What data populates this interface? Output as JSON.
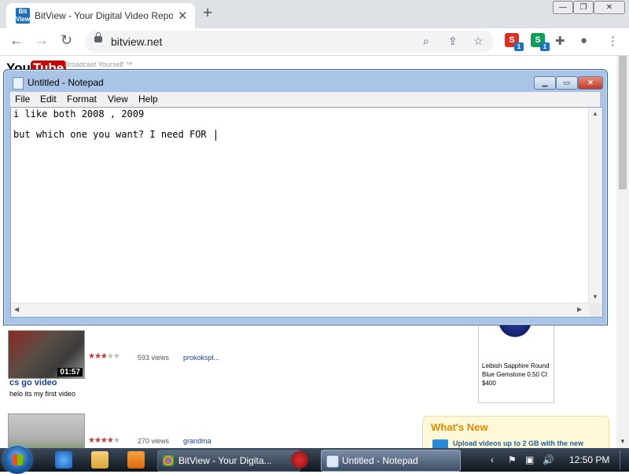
{
  "browser": {
    "tab_title": "BitView - Your Digital Video Repository",
    "favicon_text": "Bit View",
    "tab_close": "✕",
    "new_tab": "+",
    "url": "bitview.net",
    "window_controls": {
      "minimize": "—",
      "maximize": "❐",
      "close": "✕"
    },
    "nav": {
      "back": "←",
      "forward": "→",
      "reload": "↻"
    },
    "extensions": [
      {
        "name": "extension-s-1",
        "letter": "S",
        "badge": "1",
        "color": "#d93025"
      },
      {
        "name": "extension-s-2",
        "letter": "S",
        "badge": "1",
        "color": "#0f9d58"
      }
    ],
    "icons": {
      "zoom": "search-icon",
      "share": "share-icon",
      "bookmark": "star-icon",
      "extensions": "puzzle-icon",
      "profile": "person-icon",
      "menu": "kebab-menu-icon"
    }
  },
  "page": {
    "logo_you": "You",
    "logo_tube": "Tube",
    "tagline": "Broadcast Yourself ™",
    "videos": [
      {
        "title": "cs go video",
        "description": "helo its my first video",
        "duration": "01:57",
        "views": "593 views",
        "author": "prokokspl...",
        "rating": 3.5
      },
      {
        "title": "",
        "description": "",
        "duration": "",
        "views": "270 views",
        "author": "grandma",
        "rating": 4.5
      }
    ],
    "ad_text": "Leibish Sapphire Round Blue Gemstone 0.50 Ct $400",
    "whats_new": {
      "title": "What's New",
      "text": "Upload videos up to 2 GB with the new"
    }
  },
  "notepad": {
    "title": "Untitled - Notepad",
    "menus": [
      "File",
      "Edit",
      "Format",
      "View",
      "Help"
    ],
    "controls": {
      "minimize": "▁",
      "maximize": "▭",
      "close": "✕"
    },
    "lines": [
      "i like both 2008 , 2009",
      "",
      "but which one you want? I need FOR "
    ]
  },
  "taskbar": {
    "tasks": [
      {
        "label": "BitView - Your Digita...",
        "icon": "chrome-icon"
      },
      {
        "label": "Untitled - Notepad",
        "icon": "notepad-icon"
      }
    ],
    "clock": "12:50 PM",
    "tray": {
      "chevron": "‹",
      "flag": "⚑",
      "network": "▣",
      "volume": "🔊"
    }
  },
  "colors": {
    "link_blue": "#1a3f9c",
    "notepad_frame": "#a9c4e6",
    "taskbar": "#1e2a38",
    "whats_new": "#e68a00"
  }
}
